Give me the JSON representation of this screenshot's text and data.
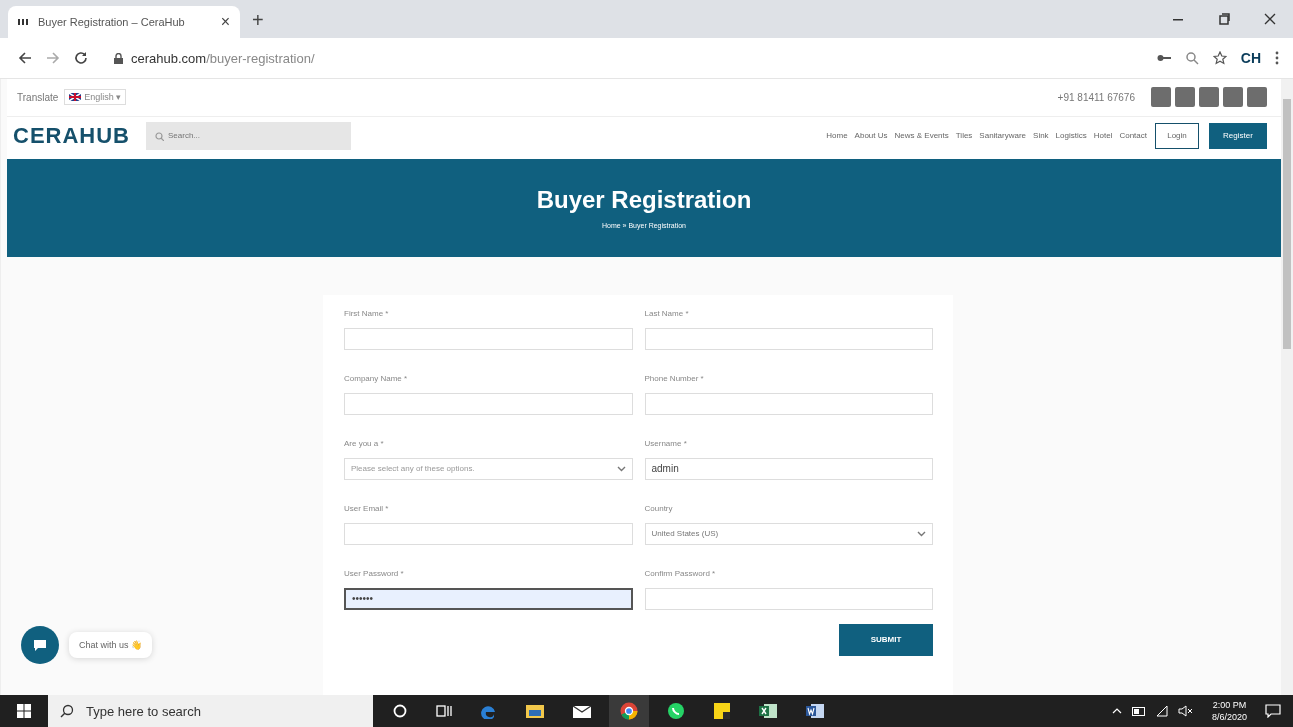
{
  "browser": {
    "tab_title": "Buyer Registration – CeraHub",
    "tab_close": "×",
    "new_tab": "+",
    "url_host": "cerahub.com",
    "url_path": "/buyer-registration/",
    "profile": "CH"
  },
  "topbar": {
    "translate_label": "Translate",
    "language": "English ▾",
    "phone": "+91 81411 67676"
  },
  "header": {
    "logo": "CERAHUB",
    "search_placeholder": "Search...",
    "nav": [
      "Home",
      "About Us",
      "News & Events",
      "Tiles",
      "Sanitaryware",
      "Sink",
      "Logistics",
      "Hotel",
      "Contact"
    ],
    "login": "Login",
    "register": "Register"
  },
  "banner": {
    "title": "Buyer Registration",
    "breadcrumb": "Home » Buyer Registration"
  },
  "form": {
    "fields": [
      {
        "label": "First Name *",
        "kind": "text",
        "focused": false
      },
      {
        "label": "Last Name *",
        "kind": "text",
        "focused": false
      },
      {
        "label": "Company Name *",
        "kind": "text",
        "focused": false
      },
      {
        "label": "Phone Number *",
        "kind": "text",
        "focused": false
      },
      {
        "label": "Are you a *",
        "kind": "select",
        "placeholder": "Please select any of these options.",
        "focused": false
      },
      {
        "label": "Username *",
        "kind": "text",
        "value": "admin",
        "focused": false
      },
      {
        "label": "User Email *",
        "kind": "text",
        "focused": false
      },
      {
        "label": "Country",
        "kind": "select",
        "value": "United States (US)",
        "focused": false
      },
      {
        "label": "User Password *",
        "kind": "password",
        "value": "••••••",
        "focused": true
      },
      {
        "label": "Confirm Password *",
        "kind": "password",
        "focused": false
      }
    ],
    "submit": "SUBMIT"
  },
  "chat": {
    "label": "Chat with us 👋"
  },
  "taskbar": {
    "search_placeholder": "Type here to search",
    "time": "2:00 PM",
    "date": "8/6/2020"
  }
}
